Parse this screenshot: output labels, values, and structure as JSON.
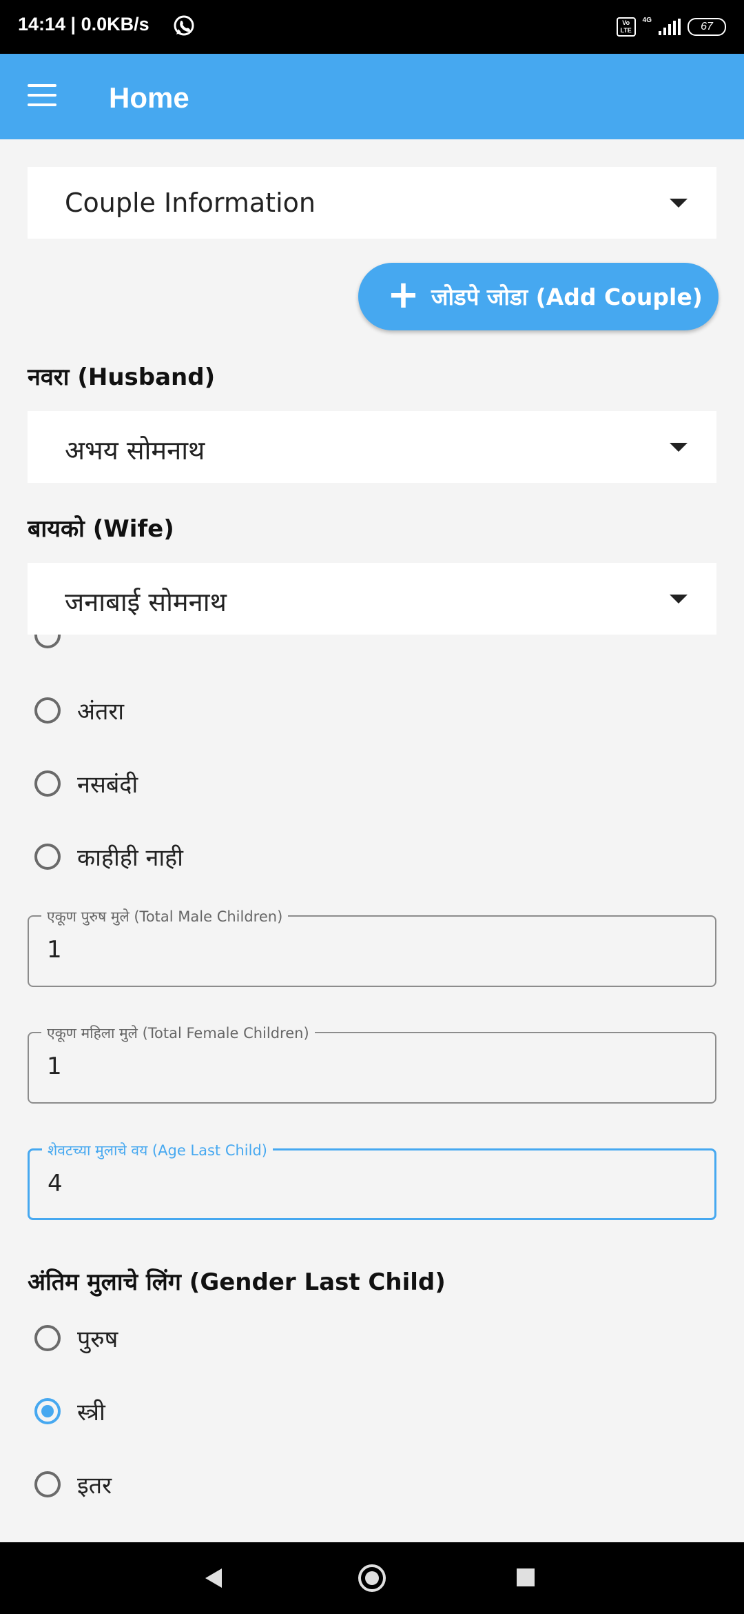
{
  "status_bar": {
    "time_speed": "14:14 | 0.0KB/s",
    "volte": "Vo LTE",
    "network": "4G",
    "battery": "67"
  },
  "app_bar": {
    "title": "Home"
  },
  "form_type_dropdown": {
    "value": "Couple Information"
  },
  "add_couple_button": {
    "icon": "plus-icon",
    "label": "जोडपे जोडा (Add Couple)"
  },
  "husband": {
    "label": "नवरा (Husband)",
    "value": "अभय सोमनाथ"
  },
  "wife": {
    "label": "बायको (Wife)",
    "value": "जनाबाई सोमनाथ"
  },
  "contraception_options": [
    {
      "label": "अंतरा",
      "checked": false
    },
    {
      "label": "नसबंदी",
      "checked": false
    },
    {
      "label": "काहीही नाही",
      "checked": false
    }
  ],
  "fields": {
    "male_children": {
      "label": "एकूण पुरुष मुले (Total Male Children)",
      "value": "1"
    },
    "female_children": {
      "label": "एकूण महिला मुले (Total Female Children)",
      "value": "1"
    },
    "age_last_child": {
      "label": "शेवटच्या मुलाचे वय (Age Last Child)",
      "value": "4"
    }
  },
  "gender_last_child": {
    "label": "अंतिम मुलाचे लिंग (Gender Last Child)",
    "options": [
      {
        "label": "पुरुष",
        "checked": false
      },
      {
        "label": "स्त्री",
        "checked": true
      },
      {
        "label": "इतर",
        "checked": false
      }
    ]
  },
  "colors": {
    "accent": "#46a8f0",
    "background": "#f4f4f4"
  }
}
